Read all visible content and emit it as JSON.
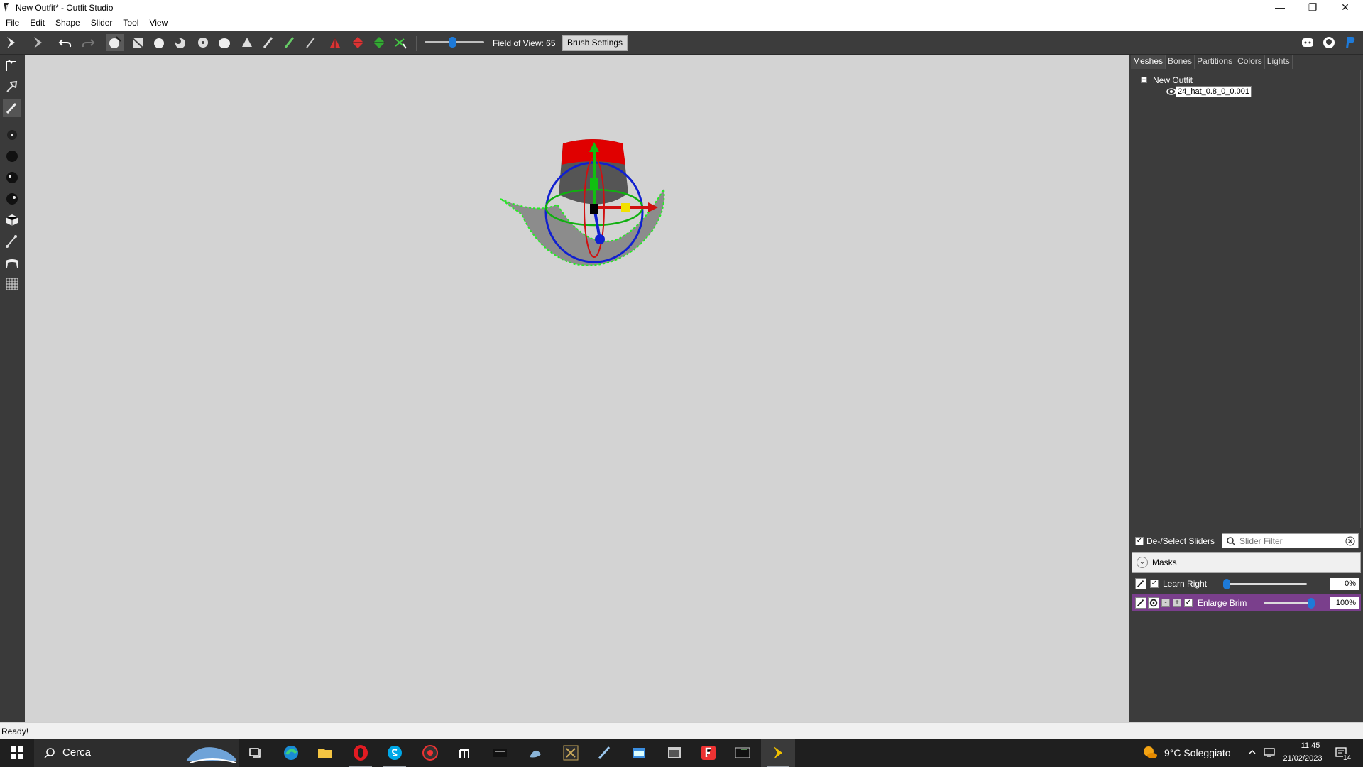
{
  "window": {
    "title": "New Outfit* - Outfit Studio",
    "minimize": "—",
    "restore": "❐",
    "close": "✕"
  },
  "menu": [
    "File",
    "Edit",
    "Shape",
    "Slider",
    "Tool",
    "View"
  ],
  "toolbar": {
    "fov_label": "Field of View: 65",
    "fov_value": 65,
    "brush_settings": "Brush Settings"
  },
  "panel": {
    "tabs": [
      "Meshes",
      "Bones",
      "Partitions",
      "Colors",
      "Lights"
    ],
    "active_tab": "Meshes",
    "tree_collapse": "−",
    "tree_root": "New Outfit",
    "tree_mesh": "24_hat_0.8_0_0.001"
  },
  "sliders_header": {
    "deselect_label": "De-/Select Sliders",
    "deselect_checked": "✓",
    "filter_placeholder": "Slider Filter"
  },
  "masks": {
    "chevron": "⌄",
    "label": "Masks"
  },
  "sliders": [
    {
      "name": "Learn Right",
      "value_text": "0%",
      "value": 0,
      "checked": "✓",
      "active": false
    },
    {
      "name": "Enlarge Brim",
      "value_text": "100%",
      "value": 100,
      "checked": "✓",
      "active": true,
      "minus": "-",
      "plus": "+"
    }
  ],
  "status": {
    "text": "Ready!"
  },
  "taskbar": {
    "search_text": "Cerca",
    "weather": "9°C Soleggiato",
    "time": "11:45",
    "date": "21/02/2023",
    "notifications": "14"
  },
  "colors": {
    "slider_accent": "#1e7ad8",
    "active_slider_row": "#7a3f8c",
    "viewport_bg": "#d3d3d3",
    "panel_bg": "#3c3c3c"
  }
}
